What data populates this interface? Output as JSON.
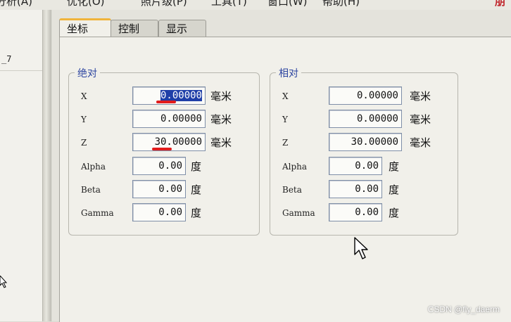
{
  "menubar": {
    "items": [
      "分析(A)",
      "优化(O)",
      "照片级(P)",
      "工具(T)",
      "窗口(W)",
      "帮助(H)"
    ],
    "brand": "朋"
  },
  "left_panel": {
    "row_label": "_7"
  },
  "tabs": [
    {
      "label": "坐标",
      "active": true
    },
    {
      "label": "控制",
      "active": false
    },
    {
      "label": "显示",
      "active": false
    }
  ],
  "absolute": {
    "title": "绝对",
    "rows": [
      {
        "label": "X",
        "value": "0.00000",
        "unit": "毫米",
        "selected": true
      },
      {
        "label": "Y",
        "value": "0.00000",
        "unit": "毫米"
      },
      {
        "label": "Z",
        "value": "30.00000",
        "unit": "毫米"
      },
      {
        "label": "Alpha",
        "value": "0.00",
        "unit": "度"
      },
      {
        "label": "Beta",
        "value": "0.00",
        "unit": "度"
      },
      {
        "label": "Gamma",
        "value": "0.00",
        "unit": "度"
      }
    ]
  },
  "relative": {
    "title": "相对",
    "rows": [
      {
        "label": "X",
        "value": "0.00000",
        "unit": "毫米"
      },
      {
        "label": "Y",
        "value": "0.00000",
        "unit": "毫米"
      },
      {
        "label": "Z",
        "value": "30.00000",
        "unit": "毫米"
      },
      {
        "label": "Alpha",
        "value": "0.00",
        "unit": "度"
      },
      {
        "label": "Beta",
        "value": "0.00",
        "unit": "度"
      },
      {
        "label": "Gamma",
        "value": "0.00",
        "unit": "度"
      }
    ]
  },
  "colors": {
    "group_title": "#2c44a0",
    "selection": "#1f3fa8",
    "annotation": "#e11c1c",
    "active_tab_accent": "#f0b43c"
  },
  "watermark": "CSDN @fly_daerm"
}
